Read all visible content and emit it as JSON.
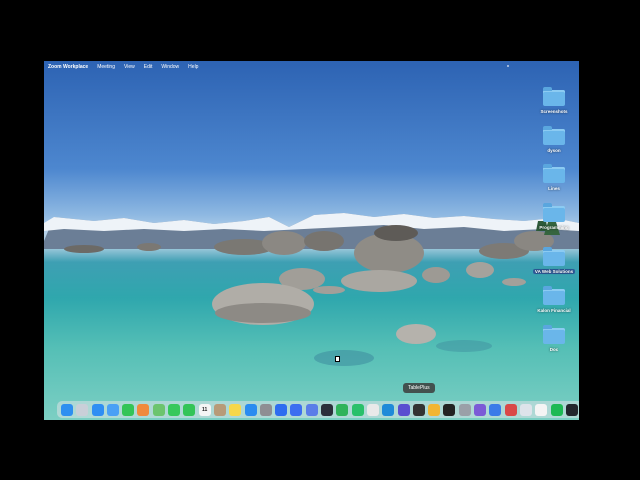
{
  "menubar": {
    "app_name": "Zoom Workplace",
    "items": [
      "Meeting",
      "View",
      "Edit",
      "Window",
      "Help"
    ]
  },
  "desktop_icons": [
    {
      "label": "Screenshots",
      "highlight": false
    },
    {
      "label": "dyson",
      "highlight": false
    },
    {
      "label": "Lines",
      "highlight": false
    },
    {
      "label": "Programming",
      "highlight": false
    },
    {
      "label": "VA Web Solutions",
      "highlight": true
    },
    {
      "label": "Kalon Financial",
      "highlight": false
    },
    {
      "label": "Doc",
      "highlight": false
    }
  ],
  "tooltip": "TablePlus",
  "dock": {
    "apps": [
      {
        "name": "finder",
        "color": "#2e8ff0",
        "glyph": ""
      },
      {
        "name": "launchpad",
        "color": "#c9cfd8",
        "glyph": ""
      },
      {
        "name": "safari",
        "color": "#2f8ef3",
        "glyph": ""
      },
      {
        "name": "mail",
        "color": "#4aa0f5",
        "glyph": ""
      },
      {
        "name": "facetime",
        "color": "#33c457",
        "glyph": ""
      },
      {
        "name": "photos",
        "color": "#f08a3c",
        "glyph": ""
      },
      {
        "name": "maps",
        "color": "#6cc46e",
        "glyph": ""
      },
      {
        "name": "messages",
        "color": "#37c85c",
        "glyph": ""
      },
      {
        "name": "phone",
        "color": "#33c457",
        "glyph": ""
      },
      {
        "name": "calendar",
        "color": "#f5f5f5",
        "glyph": "11"
      },
      {
        "name": "contacts",
        "color": "#b79a78",
        "glyph": ""
      },
      {
        "name": "notes",
        "color": "#f7d74a",
        "glyph": ""
      },
      {
        "name": "app-store",
        "color": "#2a8cf0",
        "glyph": ""
      },
      {
        "name": "system-settings",
        "color": "#8e8e93",
        "glyph": ""
      },
      {
        "name": "zoom",
        "color": "#2d6cf0",
        "glyph": ""
      },
      {
        "name": "app-blue-1",
        "color": "#3c6ef0",
        "glyph": ""
      },
      {
        "name": "app-blue-2",
        "color": "#5a7de8",
        "glyph": ""
      },
      {
        "name": "app-dark-1",
        "color": "#2b2f3a",
        "glyph": ""
      },
      {
        "name": "app-green-1",
        "color": "#2fb35a",
        "glyph": ""
      },
      {
        "name": "whatsapp",
        "color": "#29c06a",
        "glyph": ""
      },
      {
        "name": "chrome",
        "color": "#e9e9e9",
        "glyph": ""
      },
      {
        "name": "vscode",
        "color": "#1f8ad8",
        "glyph": ""
      },
      {
        "name": "app-purple-1",
        "color": "#5a4fd0",
        "glyph": ""
      },
      {
        "name": "app-dark-2",
        "color": "#333",
        "glyph": ""
      },
      {
        "name": "tableplus",
        "color": "#f2b533",
        "glyph": ""
      },
      {
        "name": "terminal",
        "color": "#222",
        "glyph": ""
      },
      {
        "name": "app-gray-1",
        "color": "#9aa0a8",
        "glyph": ""
      },
      {
        "name": "app-purple-2",
        "color": "#7b5ad6",
        "glyph": ""
      },
      {
        "name": "app-blue-3",
        "color": "#3b7be8",
        "glyph": ""
      },
      {
        "name": "app-red-1",
        "color": "#d94848",
        "glyph": ""
      },
      {
        "name": "app-light-1",
        "color": "#dde3ea",
        "glyph": ""
      },
      {
        "name": "notion",
        "color": "#f4f4f4",
        "glyph": ""
      },
      {
        "name": "spotify",
        "color": "#1db954",
        "glyph": ""
      },
      {
        "name": "app-dark-3",
        "color": "#23262d",
        "glyph": ""
      },
      {
        "name": "preview",
        "color": "#d7dde5",
        "glyph": ""
      },
      {
        "name": "downloads",
        "color": "#555b66",
        "glyph": ""
      },
      {
        "name": "trash",
        "color": "#c7ccd2",
        "glyph": ""
      }
    ]
  }
}
